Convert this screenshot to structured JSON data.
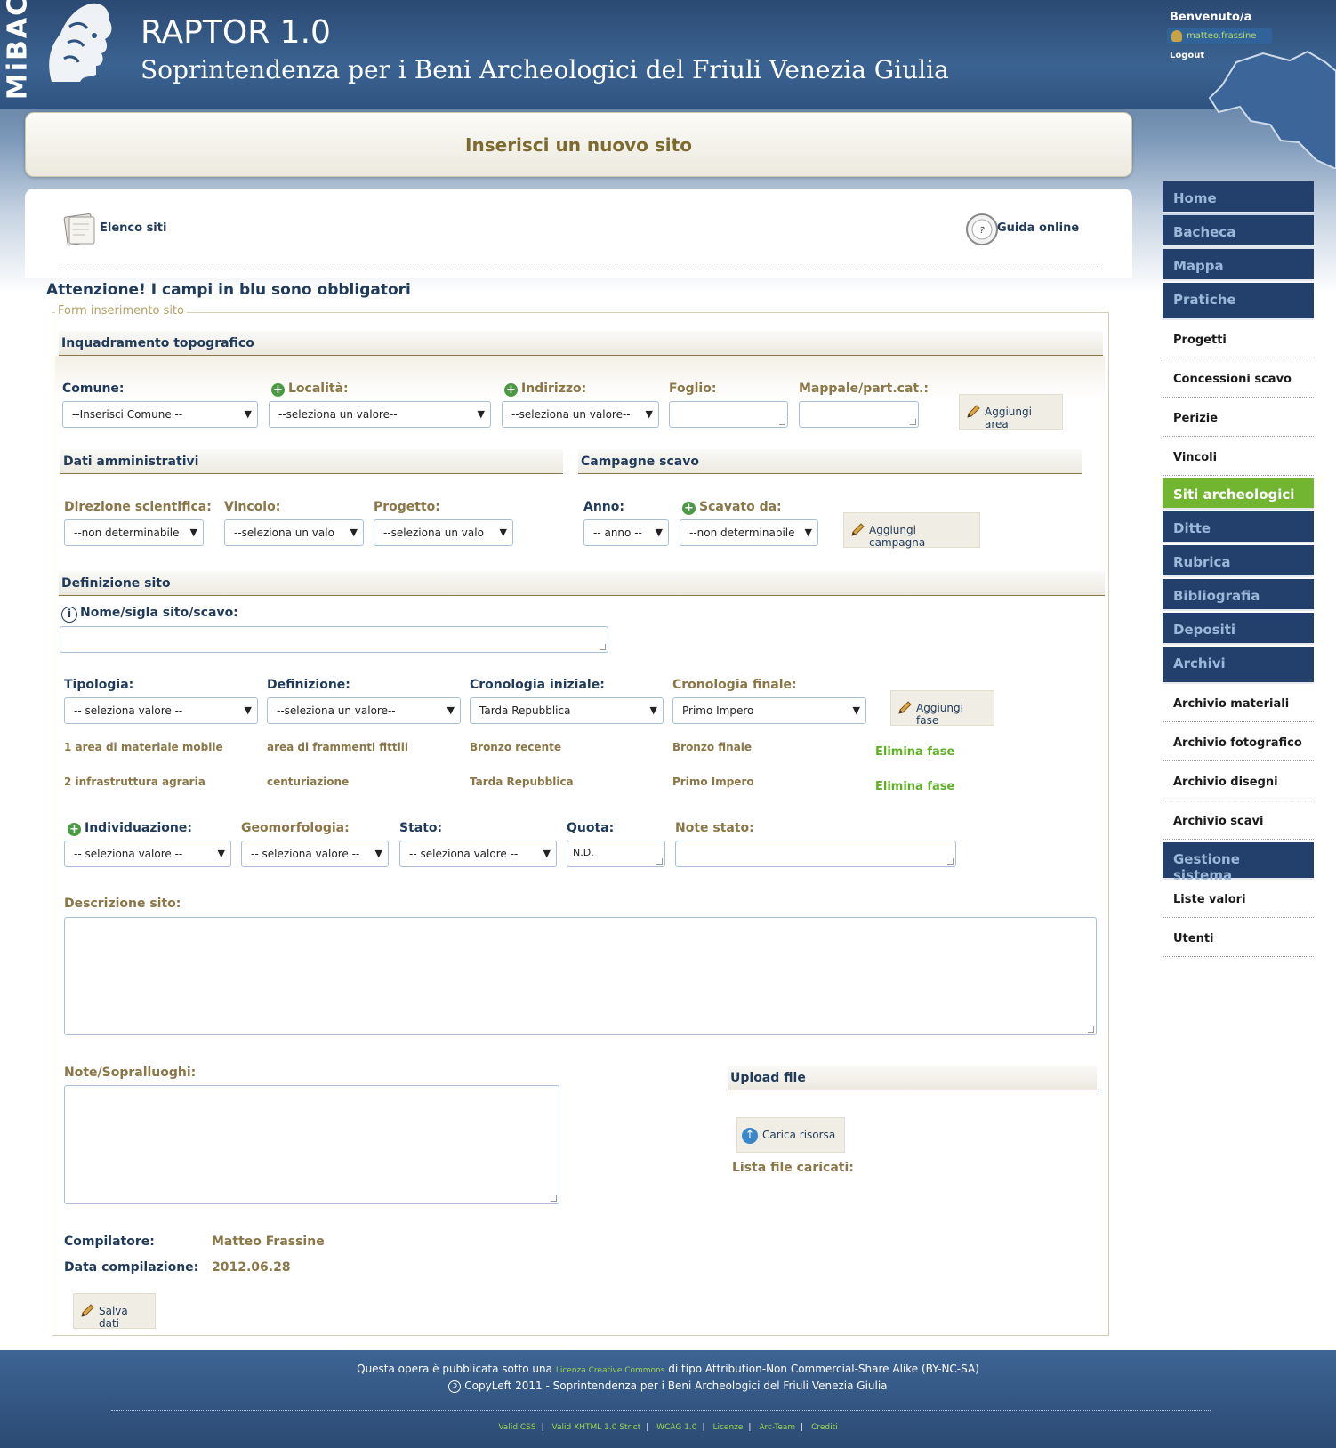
{
  "header": {
    "brand": "MiBAC",
    "title": "RAPTOR 1.0",
    "subtitle": "Soprintendenza per i Beni Archeologici del Friuli Venezia Giulia",
    "welcome": "Benvenuto/a",
    "username": "matteo.frassine",
    "logout": "Logout"
  },
  "page": {
    "title": "Inserisci un nuovo sito",
    "elenco_siti": "Elenco siti",
    "guida_online": "Guida online",
    "warning": "Attenzione! I campi in blu sono obbligatori",
    "legend": "Form inserimento sito"
  },
  "topografico": {
    "heading": "Inquadramento topografico",
    "comune_label": "Comune:",
    "comune_value": "--Inserisci Comune --",
    "localita_label": "Località:",
    "localita_value": "--seleziona un valore--",
    "indirizzo_label": "Indirizzo:",
    "indirizzo_value": "--seleziona un valore--",
    "foglio_label": "Foglio:",
    "mappale_label": "Mappale/part.cat.:",
    "aggiungi_area": "Aggiungi area"
  },
  "amministrativi": {
    "heading": "Dati amministrativi",
    "direzione_label": "Direzione scientifica:",
    "direzione_value": "--non determinabile",
    "vincolo_label": "Vincolo:",
    "vincolo_value": "--seleziona un valo",
    "progetto_label": "Progetto:",
    "progetto_value": "--seleziona un valo"
  },
  "campagne": {
    "heading": "Campagne scavo",
    "anno_label": "Anno:",
    "anno_value": "-- anno --",
    "scavato_label": "Scavato da:",
    "scavato_value": "--non determinabile",
    "aggiungi_campagna": "Aggiungi campagna"
  },
  "definizione": {
    "heading": "Definizione sito",
    "nome_label": "Nome/sigla sito/scavo:",
    "tipologia_label": "Tipologia:",
    "tipologia_value": "-- seleziona valore --",
    "definizione_label": "Definizione:",
    "definizione_value": "--seleziona un valore--",
    "cron_iniziale_label": "Cronologia iniziale:",
    "cron_iniziale_value": "Tarda Repubblica",
    "cron_finale_label": "Cronologia finale:",
    "cron_finale_value": "Primo Impero",
    "aggiungi_fase": "Aggiungi fase",
    "fasi": [
      {
        "tipologia": "1 area di materiale mobile",
        "definizione": "area di frammenti fittili",
        "iniziale": "Bronzo recente",
        "finale": "Bronzo finale",
        "action": "Elimina fase"
      },
      {
        "tipologia": "2 infrastruttura agraria",
        "definizione": "centuriazione",
        "iniziale": "Tarda Repubblica",
        "finale": "Primo Impero",
        "action": "Elimina fase"
      }
    ],
    "individuazione_label": "Individuazione:",
    "individuazione_value": "-- seleziona valore --",
    "geomorfologia_label": "Geomorfologia:",
    "geomorfologia_value": "-- seleziona valore --",
    "stato_label": "Stato:",
    "stato_value": "-- seleziona valore --",
    "quota_label": "Quota:",
    "quota_value": "N.D.",
    "note_stato_label": "Note stato:",
    "descrizione_label": "Descrizione sito:",
    "note_label": "Note/Sopralluoghi:"
  },
  "upload": {
    "heading": "Upload file",
    "carica": "Carica risorsa",
    "lista": "Lista file caricati:"
  },
  "meta": {
    "compilatore_label": "Compilatore:",
    "compilatore_value": "Matteo Frassine",
    "data_label": "Data compilazione:",
    "data_value": "2012.06.28",
    "salva": "Salva dati"
  },
  "sidebar": {
    "items": [
      {
        "label": "Home",
        "kind": "main"
      },
      {
        "label": "Bacheca",
        "kind": "main"
      },
      {
        "label": "Mappa",
        "kind": "main"
      },
      {
        "label": "Pratiche",
        "kind": "main"
      },
      {
        "label": "Progetti",
        "kind": "sub"
      },
      {
        "label": "Concessioni scavo",
        "kind": "sub"
      },
      {
        "label": "Perizie",
        "kind": "sub"
      },
      {
        "label": "Vincoli",
        "kind": "sub"
      },
      {
        "label": "Siti archeologici",
        "kind": "main-active"
      },
      {
        "label": "Ditte",
        "kind": "main"
      },
      {
        "label": "Rubrica",
        "kind": "main"
      },
      {
        "label": "Bibliografia",
        "kind": "main"
      },
      {
        "label": "Depositi",
        "kind": "main"
      },
      {
        "label": "Archivi",
        "kind": "main"
      },
      {
        "label": "Archivio materiali",
        "kind": "sub"
      },
      {
        "label": "Archivio fotografico",
        "kind": "sub"
      },
      {
        "label": "Archivio disegni",
        "kind": "sub"
      },
      {
        "label": "Archivio scavi",
        "kind": "sub"
      },
      {
        "label": "Gestione sistema",
        "kind": "main"
      },
      {
        "label": "Liste valori",
        "kind": "sub"
      },
      {
        "label": "Utenti",
        "kind": "sub"
      }
    ]
  },
  "footer": {
    "line1_pre": "Questa opera è pubblicata sotto una",
    "line1_link": "Licenza Creative Commons",
    "line1_post": "di tipo Attribution-Non Commercial-Share Alike (BY-NC-SA)",
    "line2": "CopyLeft 2011 - Soprintendenza per i Beni Archeologici del Friuli Venezia Giulia",
    "links": [
      "Valid CSS",
      "Valid XHTML 1.0 Strict",
      "WCAG 1.0",
      "Licenze",
      "Arc-Team",
      "Crediti"
    ]
  },
  "colors": {
    "header_blue": "#2b4a73",
    "nav_blue": "#233f6b",
    "nav_active_green": "#71b531",
    "required_label": "#1f3a5a",
    "optional_label": "#8a7646",
    "elimina_green": "#5fae25"
  }
}
